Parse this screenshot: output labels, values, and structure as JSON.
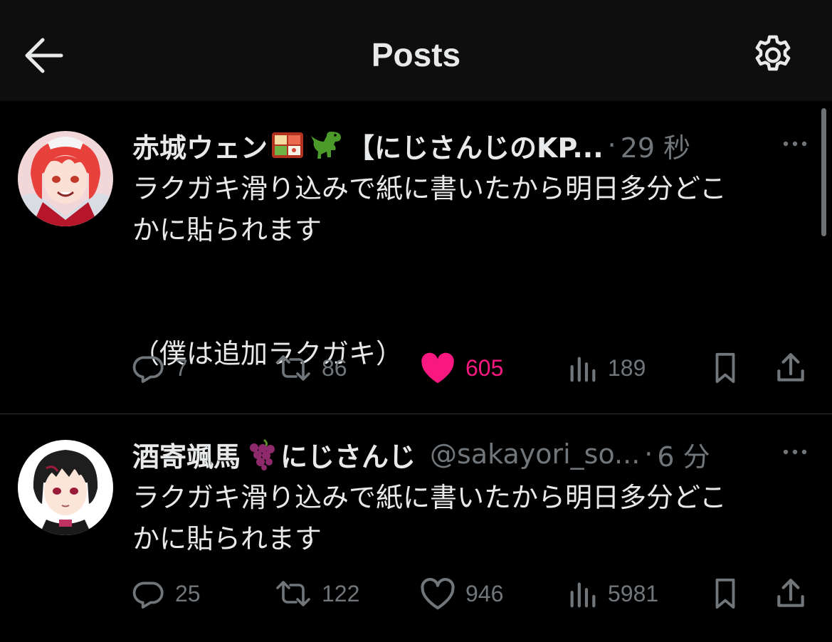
{
  "header": {
    "title": "Posts",
    "back_icon": "arrow-left-icon",
    "settings_icon": "gear-icon"
  },
  "colors": {
    "background": "#000000",
    "text": "#e7e9ea",
    "muted": "#71767b",
    "like_pink": "#f91880",
    "divider": "#2f3336"
  },
  "posts": [
    {
      "display_name": "赤城ウェン",
      "emojis": [
        "bento-box-emoji",
        "t-rex-emoji"
      ],
      "name_suffix": "【にじさんじのKP...",
      "handle": "",
      "separator": "·",
      "time": "29 秒",
      "text": "ラクガキ滑り込みで紙に書いたから明日多分どこ\nかに貼られます\n\n\n（僕は追加ラクガキ）",
      "replies": "7",
      "reposts": "86",
      "likes": "605",
      "liked": true,
      "views": "189"
    },
    {
      "display_name": "酒寄颯馬",
      "emojis": [
        "grapes-emoji"
      ],
      "name_suffix": "にじさんじ",
      "handle": "@sakayori_so...",
      "separator": "·",
      "time": "6 分",
      "text": "ラクガキ滑り込みで紙に書いたから明日多分どこ\nかに貼られます",
      "replies": "25",
      "reposts": "122",
      "likes": "946",
      "liked": false,
      "views": "5981"
    }
  ]
}
